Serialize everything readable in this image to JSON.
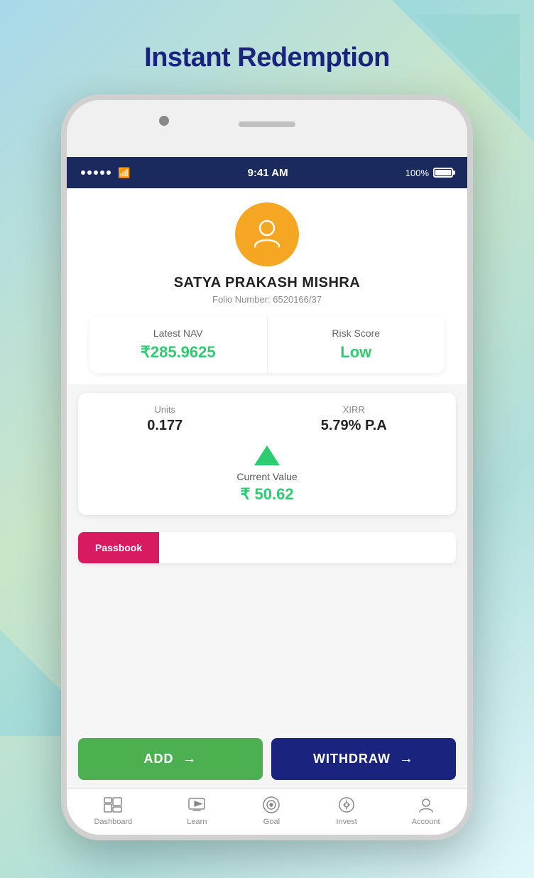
{
  "page": {
    "title": "Instant Redemption"
  },
  "statusBar": {
    "time": "9:41 AM",
    "battery": "100%"
  },
  "profile": {
    "name": "SATYA PRAKASH MISHRA",
    "folioLabel": "Folio Number:",
    "folioNumber": "6520166/37"
  },
  "navCard": {
    "latestNavLabel": "Latest NAV",
    "latestNavValue": "₹285.9625",
    "riskScoreLabel": "Risk Score",
    "riskScoreValue": "Low"
  },
  "statsCard": {
    "unitsLabel": "Units",
    "unitsValue": "0.177",
    "xirrLabel": "XIRR",
    "xirrValue": "5.79% P.A",
    "currentValueLabel": "Current Value",
    "currentValueAmount": "₹ 50.62"
  },
  "passbook": {
    "activeTab": "Passbook"
  },
  "buttons": {
    "add": "ADD",
    "withdraw": "WITHDRAW"
  },
  "bottomNav": {
    "items": [
      {
        "label": "Dashboard",
        "icon": "dashboard"
      },
      {
        "label": "Learn",
        "icon": "learn"
      },
      {
        "label": "Goal",
        "icon": "goal"
      },
      {
        "label": "Invest",
        "icon": "invest"
      },
      {
        "label": "Account",
        "icon": "account"
      }
    ]
  }
}
